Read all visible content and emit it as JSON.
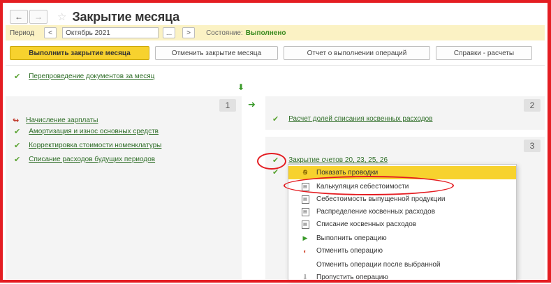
{
  "window": {
    "nav_back": "←",
    "nav_forward": "→",
    "title": "Закрытие месяца"
  },
  "period": {
    "label": "Период",
    "prev": "<",
    "value": "Октябрь 2021",
    "dots": "...",
    "next": ">",
    "state_label": "Состояние:",
    "state_value": "Выполнено"
  },
  "toolbar": {
    "run": "Выполнить закрытие месяца",
    "cancel": "Отменить закрытие месяца",
    "report": "Отчет о выполнении операций",
    "help": "Справки - расчеты"
  },
  "top_step": {
    "label": "Перепроведение документов за месяц"
  },
  "panel1": {
    "number": "1",
    "items": [
      {
        "label": "Начисление зарплаты",
        "status": "partial"
      },
      {
        "label": "Амортизация и износ основных средств",
        "status": "done"
      },
      {
        "label": "Корректировка стоимости номенклатуры",
        "status": "done"
      },
      {
        "label": "Списание расходов будущих периодов",
        "status": "done"
      }
    ]
  },
  "panel2": {
    "number": "2",
    "items": [
      {
        "label": "Расчет долей списания косвенных расходов"
      }
    ]
  },
  "panel3": {
    "number": "3",
    "items": [
      {
        "label": "Закрытие счетов 20, 23, 25, 26"
      }
    ]
  },
  "menu": {
    "items": [
      {
        "label": "Показать проводки",
        "icon": "postings-icon"
      },
      {
        "label": "Калькуляция себестоимости",
        "icon": "report-icon"
      },
      {
        "label": "Себестоимость выпущенной продукции",
        "icon": "report-icon"
      },
      {
        "label": "Распределение косвенных расходов",
        "icon": "report-icon"
      },
      {
        "label": "Списание косвенных расходов",
        "icon": "report-icon"
      },
      {
        "label": "Выполнить операцию",
        "icon": "run-icon"
      },
      {
        "label": "Отменить операцию",
        "icon": "cancel-icon"
      },
      {
        "label": "Отменить операции после выбранной",
        "icon": ""
      },
      {
        "label": "Пропустить операцию",
        "icon": "skip-icon"
      }
    ]
  },
  "colors": {
    "accent": "#f7d22e",
    "link": "#2f6e28",
    "check": "#5aa332",
    "annotation": "#e41d22"
  }
}
